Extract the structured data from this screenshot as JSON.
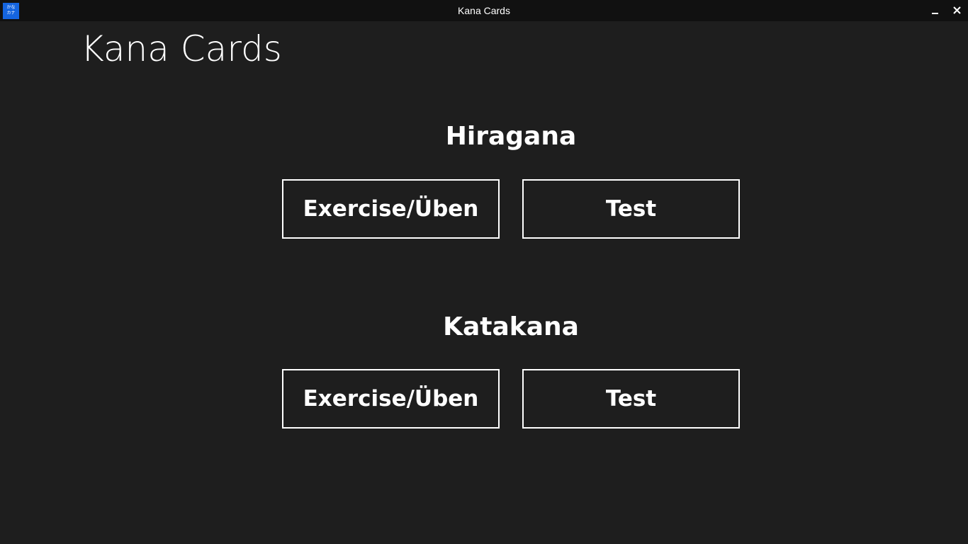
{
  "window": {
    "title": "Kana Cards",
    "icon": {
      "name": "kana-app-icon",
      "line1": "かな",
      "line2": "カナ",
      "color": "#1565e0"
    },
    "controls": {
      "minimize_icon": "minimize-icon",
      "close_icon": "close-icon"
    }
  },
  "colors": {
    "background": "#1e1e1e",
    "titlebar": "#111111",
    "foreground": "#ffffff"
  },
  "page": {
    "heading": "Kana Cards"
  },
  "sections": [
    {
      "title": "Hiragana",
      "exercise_label": "Exercise/Üben",
      "test_label": "Test"
    },
    {
      "title": "Katakana",
      "exercise_label": "Exercise/Üben",
      "test_label": "Test"
    }
  ]
}
